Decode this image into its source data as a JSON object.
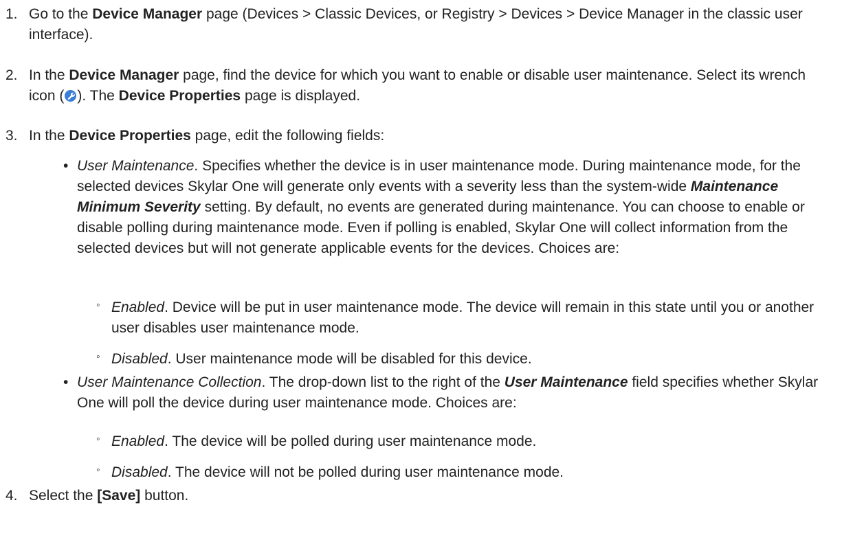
{
  "steps": [
    {
      "num": "1.",
      "t1": "Go to the ",
      "b1": "Device Manager",
      "t2": " page (Devices > Classic Devices, or Registry > Devices > Device Manager in the classic user interface)."
    },
    {
      "num": "2.",
      "t1": "In the ",
      "b1": "Device Manager",
      "t2": " page, find the device for which you want to enable or disable user maintenance. Select its wrench icon (",
      "icon": "wrench-icon",
      "t3": "). The ",
      "b2": "Device Properties",
      "t4": " page is displayed."
    },
    {
      "num": "3.",
      "t1": "In the ",
      "b1": "Device Properties",
      "t2": " page, edit the following fields:"
    },
    {
      "num": "4.",
      "t1": "Select the ",
      "b1": "[Save]",
      "t2": " button."
    }
  ],
  "fields": [
    {
      "name": "User Maintenance",
      "t1": ". Specifies whether the device is in user maintenance mode. During maintenance mode, for the selected devices Skylar One will generate only events with a severity less than the system-wide ",
      "b1": "Maintenance Minimum Severity",
      "t2": " setting. By default, no events are generated during maintenance. You can choose to enable or disable polling during maintenance mode. Even if polling is enabled, Skylar One will collect information from the selected devices but will not generate applicable events for the devices. Choices are:",
      "choices": [
        {
          "name": "Enabled",
          "text": ". Device will be put in user maintenance mode. The device will remain in this state until you or another user disables user maintenance mode."
        },
        {
          "name": "Disabled",
          "text": ". User maintenance mode will be disabled for this device."
        }
      ]
    },
    {
      "name": "User Maintenance Collection",
      "t1": ". The drop-down list to the right of the ",
      "b1": "User Maintenance",
      "t2": " field specifies whether Skylar One will poll the device during user maintenance mode. Choices are:",
      "choices": [
        {
          "name": "Enabled",
          "text": ". The device will be polled during user maintenance mode."
        },
        {
          "name": "Disabled",
          "text": ". The device will not be polled during user maintenance mode."
        }
      ]
    }
  ],
  "bullet_glyph": "•",
  "subbullet_glyph": "◦",
  "colors": {
    "text": "#222222",
    "icon_blue": "#3a7fd5",
    "icon_wrench": "#ffffff"
  }
}
